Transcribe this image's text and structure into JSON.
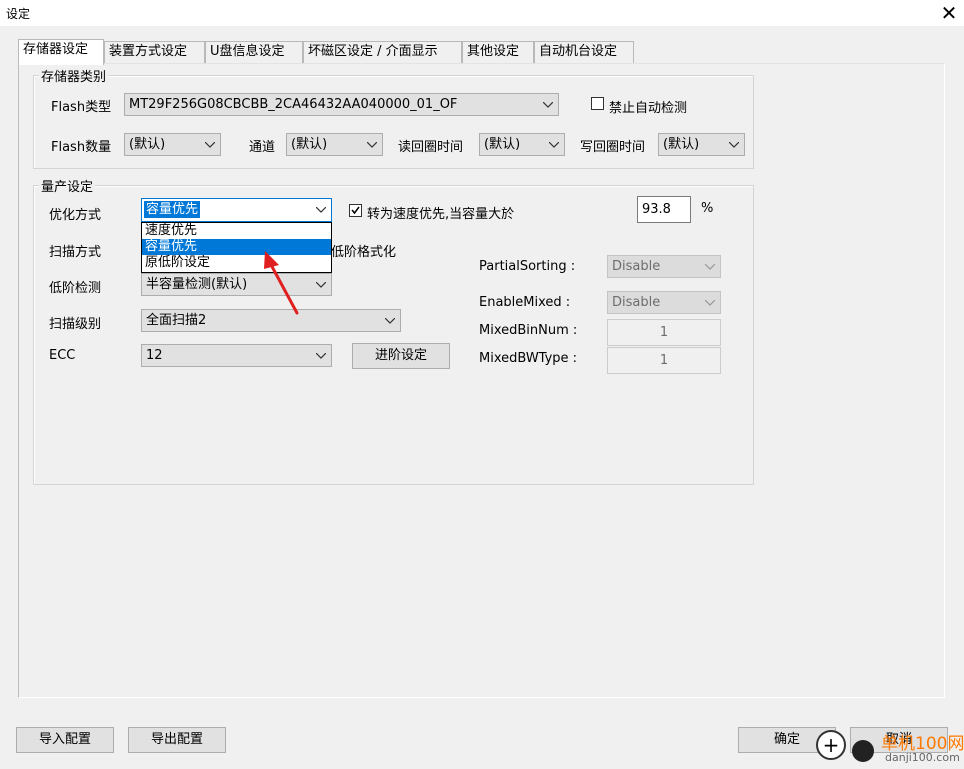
{
  "window": {
    "title": "设定",
    "close_glyph": "✕"
  },
  "tabs": [
    {
      "label": "存储器设定"
    },
    {
      "label": "装置方式设定"
    },
    {
      "label": "U盘信息设定"
    },
    {
      "label": "坏磁区设定 / 介面显示"
    },
    {
      "label": "其他设定"
    },
    {
      "label": "自动机台设定"
    }
  ],
  "storage_type": {
    "legend": "存储器类别",
    "flash_type_label": "Flash类型",
    "flash_type_value": "MT29F256G08CBCBB_2CA46432AA040000_01_OF",
    "disable_autodetect_label": "禁止自动检测",
    "flash_count_label": "Flash数量",
    "flash_count_value": "(默认)",
    "channel_label": "通道",
    "channel_value": "(默认)",
    "read_cycle_label": "读回圈时间",
    "read_cycle_value": "(默认)",
    "write_cycle_label": "写回圈时间",
    "write_cycle_value": "(默认)"
  },
  "production": {
    "legend": "量产设定",
    "optimize_label": "优化方式",
    "optimize_value": "容量优先",
    "optimize_options": [
      "速度优先",
      "容量优先",
      "原低阶设定"
    ],
    "speed_switch_label": "转为速度优先,当容量大於",
    "speed_switch_value": "93.8",
    "percent": "%",
    "scan_mode_label": "扫描方式",
    "lowlevel_format_label": "低阶格式化",
    "lowlevel_detect_label": "低阶检测",
    "lowlevel_detect_value": "半容量检测(默认)",
    "scan_level_label": "扫描级别",
    "scan_level_value": "全面扫描2",
    "ecc_label": "ECC",
    "ecc_value": "12",
    "advanced_button": "进阶设定",
    "partial_sorting_label": "PartialSorting :",
    "partial_sorting_value": "Disable",
    "enable_mixed_label": "EnableMixed :",
    "enable_mixed_value": "Disable",
    "mixed_bin_num_label": "MixedBinNum :",
    "mixed_bin_num_value": "1",
    "mixed_bw_type_label": "MixedBWType :",
    "mixed_bw_type_value": "1"
  },
  "footer": {
    "import_button": "导入配置",
    "export_button": "导出配置",
    "ok_button": "确定",
    "cancel_button": "取消"
  },
  "watermark": {
    "text": "单机100网",
    "url": "danji100.com"
  },
  "colors": {
    "selection": "#0078d7",
    "annotation_arrow": "#e02020"
  }
}
